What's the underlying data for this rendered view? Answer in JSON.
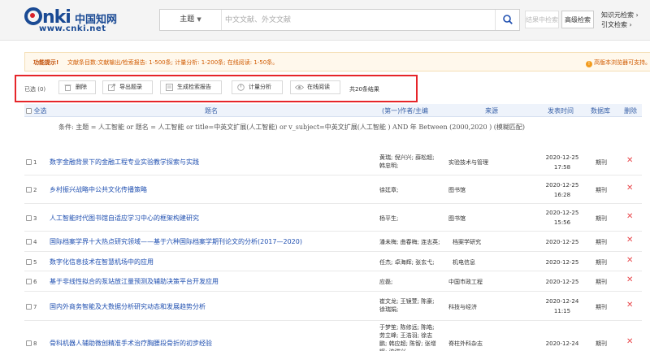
{
  "header": {
    "logo_mark": "nki",
    "logo_cn": "中国知网",
    "logo_url": "www.cnki.net",
    "search_scope": "主题",
    "search_placeholder": "中文文献、外文文献",
    "result_search_label": "结果中检索",
    "advanced_search_label": "高级检索",
    "knowledge_search_label": "知识元检索 ›",
    "citation_search_label": "引文检索 ›"
  },
  "notice": {
    "lead": "功能提示!",
    "message": "文献条目数:文献输出/检索报告: 1-500条; 计量分析: 1-200条; 在线阅读: 1-50条。",
    "browser_tip": "高版本浏览器可支持。"
  },
  "toolbar": {
    "selected": "已选 (0)",
    "buttons": [
      "删除",
      "导出题录",
      "生成检索报告",
      "计量分析",
      "在线阅读"
    ],
    "total": "共20条结果"
  },
  "table": {
    "columns": [
      "全选",
      "题名",
      "(第一)作者/主编",
      "来源",
      "发表时间",
      "数据库",
      "删除"
    ],
    "condition": "条件:  主题 = 人工智能 or 题名 = 人工智能 or title=中英文扩展(人工智能) or v_subject=中英文扩展(人工智能 ) AND 年 Between (2000,2020 ) (模糊匹配)",
    "rows": [
      {
        "num": "1",
        "title": "数字金融背景下的金融工程专业实验教学探索与实践",
        "author": "黄瑞; 倪兴兴; 薛松超; 韩忠明;",
        "source": "实验技术与管理",
        "date": "2020-12-25",
        "time": "17:58",
        "db": "期刊"
      },
      {
        "num": "2",
        "title": "乡村振兴战略中公共文化传播策略",
        "author": "徐廷章;",
        "source": "图书馆",
        "date": "2020-12-25",
        "time": "16:28",
        "db": "期刊"
      },
      {
        "num": "3",
        "title": "人工智能时代图书馆自适应学习中心的框架构建研究",
        "author": "杨平生;",
        "source": "图书馆",
        "date": "2020-12-25",
        "time": "15:56",
        "db": "期刊"
      },
      {
        "num": "4",
        "title": "国际档案学界十大热点研究领域——基于六种国际档案学期刊论文的分析(2017—2020)",
        "author": "潘未梅; 曲春梅; 连志英;",
        "source": "档案学研究",
        "date": "2020-12-25",
        "time": "",
        "db": "期刊"
      },
      {
        "num": "5",
        "title": "数字化信息技术在智慧机场中的应用",
        "author": "任杰; 卓海辉; 张玄弋;",
        "source": "机电信息",
        "date": "2020-12-25",
        "time": "",
        "db": "期刊"
      },
      {
        "num": "6",
        "title": "基于非线性拟合的泵站放江量预测及辅助决策平台开发应用",
        "author": "应磊;",
        "source": "中国市政工程",
        "date": "2020-12-25",
        "time": "",
        "db": "期刊"
      },
      {
        "num": "7",
        "title": "国内外商务智能及大数据分析研究动态和发展趋势分析",
        "author": "崔文龙; 王镜萱; 陈豪; 徐瑞娟;",
        "source": "科技与经济",
        "date": "2020-12-24",
        "time": "11:15",
        "db": "期刊"
      },
      {
        "num": "8",
        "title": "骨科机器人辅助微创精准手术治疗胸腰段骨折的初步经验",
        "author": "于梦笙; 陈修远; 陈皓; 劳立峰; 王浩羽; 徐志鹏; 韩应超; 陈智; 张增辉; 沈洪兴",
        "source": "脊柱外科杂志",
        "date": "2020-12-24",
        "time": "",
        "db": "期刊"
      }
    ]
  },
  "colors": {
    "link": "#1f4fb0",
    "highlight_box": "#e6252a",
    "delete": "#e8464a",
    "notice_text": "#d05a00"
  }
}
